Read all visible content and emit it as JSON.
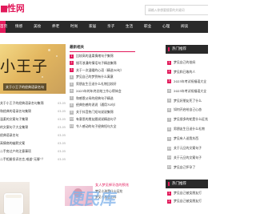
{
  "site": {
    "logo_text": "性网"
  },
  "search": {
    "placeholder": "请输入你想要搜索的关键词"
  },
  "nav": {
    "items": [
      "首页",
      "情感",
      "美妆",
      "养老",
      "时尚",
      "家居",
      "亲子",
      "生活",
      "职业",
      "心理",
      "阅读"
    ]
  },
  "hero": {
    "title": "小王子",
    "caption": "关于小王子的经典语录名句"
  },
  "left_list": [
    {
      "text": "关于小王子的经典语录名句集锦",
      "date": "03-05"
    },
    {
      "text": "和经典的语录名句集锦",
      "date": "03-05"
    },
    {
      "text": "温柔的文案句子集锦",
      "date": "03-05"
    },
    {
      "text": "的文案句子大全集锦",
      "date": "03-05"
    },
    {
      "text": "经典语录名句",
      "date": "03-05"
    },
    {
      "text": "高情商的幽默文案",
      "date": "03-05"
    },
    {
      "text": "二手房过户的注意事项",
      "date": "03-05"
    },
    {
      "text": "二手相册投诉名言,难道“无聊”？",
      "date": "03-05"
    }
  ],
  "middle": {
    "title": "最新相关",
    "items": [
      {
        "num": "1",
        "text": "比较高的温柔情绪句子集锦"
      },
      {
        "num": "2",
        "text": "描写浪漫的情话句子精选集锦"
      },
      {
        "num": "3",
        "text": "关于一次温暖的心语（精选30句）"
      },
      {
        "num": "4",
        "text": "梦见自己的梦到有什么寓意"
      },
      {
        "num": "5",
        "text": "男朋友生日送什么礼物比较好"
      },
      {
        "num": "6",
        "text": "2023年的年终总结工作心得体会"
      },
      {
        "num": "7",
        "text": "和感恩父母的经典句子精选"
      },
      {
        "num": "8",
        "text": "经典伤感的说说（通用70句）"
      },
      {
        "num": "9",
        "text": "关于抖音热门短句说说集锦"
      },
      {
        "num": "10",
        "text": "有意思的朋友圈说说精选句子"
      },
      {
        "num": "11",
        "text": "令人感动的句子经典短句大全"
      }
    ]
  },
  "sidebar": {
    "hot_title": "热门推荐",
    "hot_items": [
      {
        "num": "1",
        "text": "梦见自己的爸妈"
      },
      {
        "num": "2",
        "text": "梦见和已故的人"
      },
      {
        "num": "3",
        "text": "2023年考试祝福语大全"
      },
      {
        "num": "4",
        "text": "2023年考试祝福语大全"
      },
      {
        "num": "5",
        "text": "梦见好朋友死了什么"
      },
      {
        "num": "6",
        "text": "如何开启给自己心态"
      },
      {
        "num": "7",
        "text": "梦见很多的蛇是什么征兆"
      },
      {
        "num": "8",
        "text": "男朋友生日送什么礼物"
      },
      {
        "num": "9",
        "text": "梦见有人送我东西"
      },
      {
        "num": "10",
        "text": "关于元旦的文案句子"
      },
      {
        "num": "11",
        "text": "关于元旦的文案句子"
      },
      {
        "num": "12",
        "text": "梦见自己怀孕了"
      }
    ],
    "bottom_title": "热门推荐",
    "bottom_items": [
      {
        "num": "1",
        "text": "梦见自己被女朋友打"
      },
      {
        "num": "2",
        "text": "梦见自己被女朋友打"
      }
    ]
  },
  "bottom": {
    "title": "女人梦见掉牙齿的预兆",
    "lines": [
      "梦见小孩是什么征兆",
      "梦见小孩会怎样"
    ]
  },
  "watermark": {
    "text": "便民库"
  },
  "colors": {
    "accent": "#e21a5b",
    "dark": "#2a2a2a"
  }
}
